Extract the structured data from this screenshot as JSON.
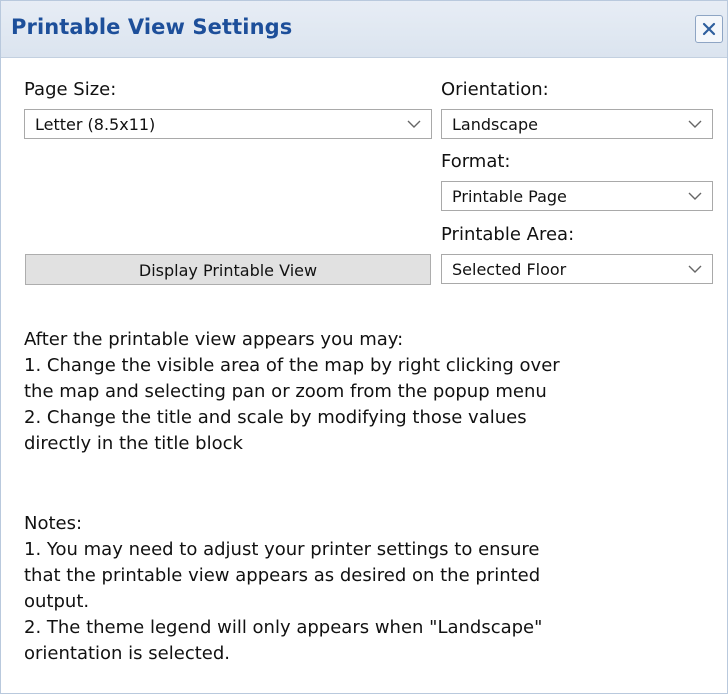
{
  "dialog": {
    "title": "Printable View Settings",
    "close_icon": "close-icon"
  },
  "page_size": {
    "label": "Page Size:",
    "value": "Letter (8.5x11)"
  },
  "orientation": {
    "label": "Orientation:",
    "value": "Landscape"
  },
  "format": {
    "label": "Format:",
    "value": "Printable Page"
  },
  "printable_area": {
    "label": "Printable Area:",
    "value": "Selected Floor"
  },
  "display_button_label": "Display Printable View",
  "instructions": {
    "intro": "After the printable view appears you may:",
    "lines": [
      "1. Change the visible area of the map by right clicking over",
      "the map and selecting pan or zoom from the popup menu",
      "2. Change the title and scale by modifying those values",
      "directly in the title block"
    ]
  },
  "notes": {
    "heading": "Notes:",
    "lines": [
      "1. You may need to adjust your printer settings to ensure",
      "that the printable view appears as desired on the printed",
      "output.",
      "2. The theme legend will only appears when \"Landscape\"",
      "orientation is selected."
    ]
  },
  "colors": {
    "title_text": "#1d4f9a",
    "titlebar_bg": "#dbe4ef",
    "button_bg": "#e1e1e1"
  }
}
